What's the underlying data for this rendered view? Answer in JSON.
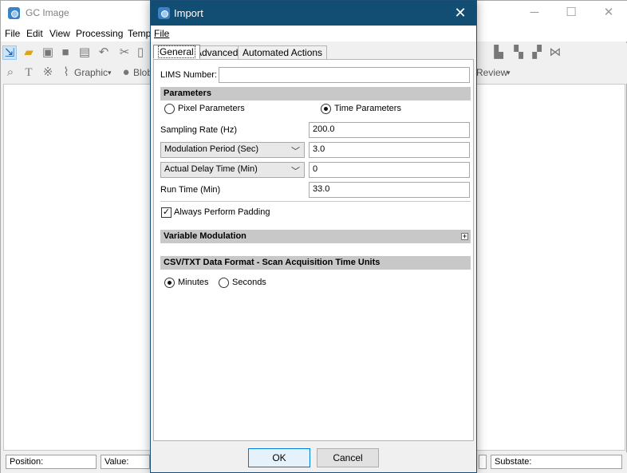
{
  "main_window": {
    "title": "GC Image",
    "menu": [
      "File",
      "Edit",
      "View",
      "Processing",
      "Temp"
    ],
    "toolbar2": {
      "graphic_label": "Graphic",
      "blob_label": "Blob",
      "review_label": "Review"
    },
    "status": {
      "position_label": "Position:",
      "value_label": "Value:",
      "substate_label": "Substate:"
    }
  },
  "dialog": {
    "title": "Import",
    "menu_file": "File",
    "tabs": [
      {
        "label": "General",
        "active": true
      },
      {
        "label": "Advanced",
        "active": false
      },
      {
        "label": "Automated Actions",
        "active": false
      }
    ],
    "lims_label": "LIMS Number:",
    "lims_value": "",
    "parameters": {
      "header": "Parameters",
      "pixel_label": "Pixel Parameters",
      "pixel_selected": false,
      "time_label": "Time Parameters",
      "time_selected": true,
      "sampling_rate_label": "Sampling Rate (Hz)",
      "sampling_rate_value": "200.0",
      "modulation_select": "Modulation Period (Sec)",
      "modulation_value": "3.0",
      "delay_select": "Actual Delay Time (Min)",
      "delay_value": "0",
      "run_time_label": "Run Time (Min)",
      "run_time_value": "33.0",
      "padding_label": "Always Perform Padding",
      "padding_checked": true
    },
    "variable_modulation_header": "Variable Modulation",
    "csv_header": "CSV/TXT Data Format - Scan Acquisition Time Units",
    "csv_minutes_label": "Minutes",
    "csv_minutes_selected": true,
    "csv_seconds_label": "Seconds",
    "csv_seconds_selected": false,
    "ok_label": "OK",
    "cancel_label": "Cancel"
  },
  "colors": {
    "dialog_titlebar": "#124d73",
    "section_header": "#c8c8c8",
    "default_button_border": "#0078d7"
  }
}
